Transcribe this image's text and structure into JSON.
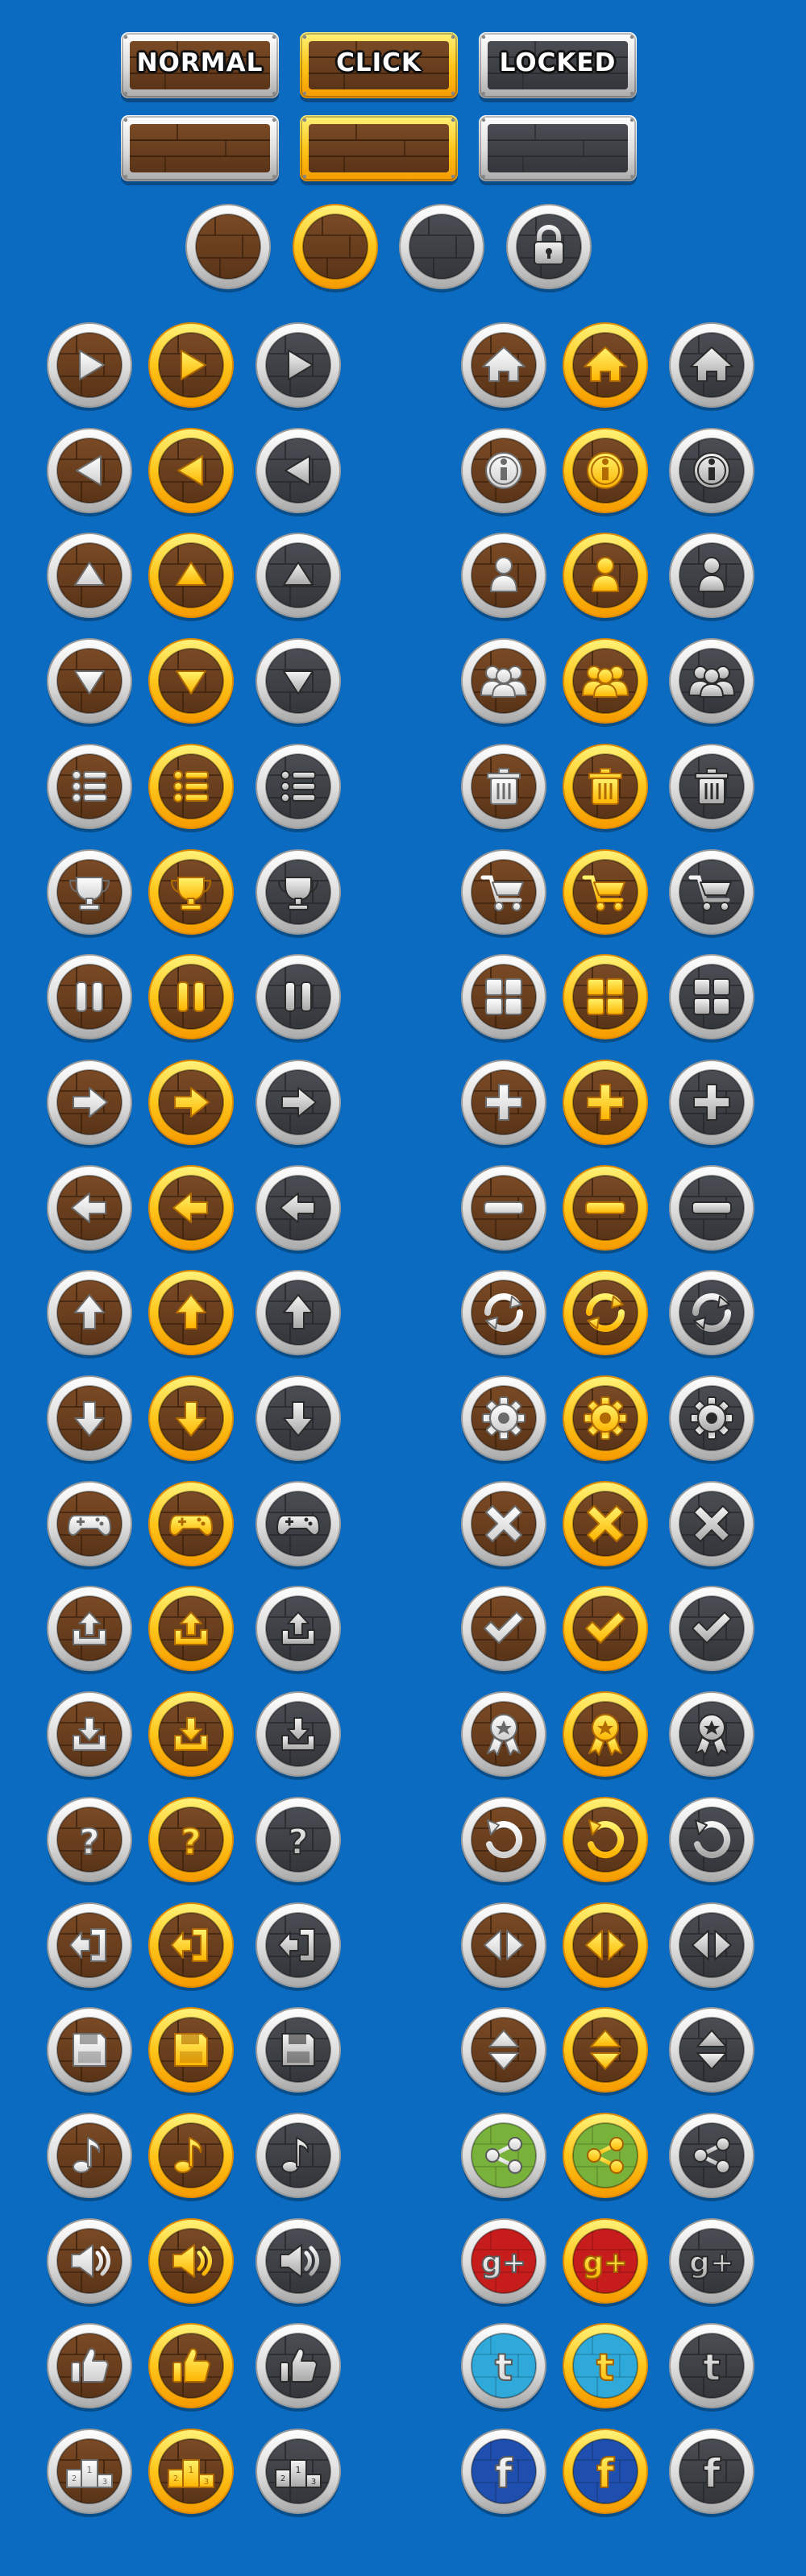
{
  "rect_buttons": [
    {
      "label": "NORMAL",
      "state": "normal",
      "has_label": true
    },
    {
      "label": "CLICK",
      "state": "click",
      "has_label": true
    },
    {
      "label": "LOCKED",
      "state": "locked",
      "has_label": true
    },
    {
      "label": "",
      "state": "normal",
      "has_label": false
    },
    {
      "label": "",
      "state": "click",
      "has_label": false
    },
    {
      "label": "",
      "state": "locked",
      "has_label": false
    }
  ],
  "state_circles": [
    {
      "state": "normal",
      "icon": "none"
    },
    {
      "state": "click",
      "icon": "none"
    },
    {
      "state": "locked",
      "icon": "none"
    },
    {
      "state": "locked",
      "icon": "padlock-icon"
    }
  ],
  "states": [
    "normal",
    "click",
    "locked"
  ],
  "icons_left": [
    "play-icon",
    "arrow-left-triangle-icon",
    "arrow-up-triangle-icon",
    "arrow-down-triangle-icon",
    "list-icon",
    "trophy-icon",
    "pause-icon",
    "arrow-right-icon",
    "arrow-left-icon",
    "arrow-up-icon",
    "arrow-down-icon",
    "gamepad-icon",
    "upload-icon",
    "download-icon",
    "question-icon",
    "exit-icon",
    "save-icon",
    "music-note-icon",
    "sound-icon",
    "thumbs-up-icon",
    "podium-icon"
  ],
  "icons_right": [
    "home-icon",
    "info-icon",
    "user-icon",
    "group-icon",
    "trash-icon",
    "cart-icon",
    "grid-icon",
    "plus-icon",
    "minus-icon",
    "refresh-icon",
    "gear-icon",
    "close-icon",
    "check-icon",
    "award-icon",
    "replay-icon",
    "left-right-icon",
    "up-down-icon",
    "share-icon",
    "google-plus-icon",
    "twitter-icon",
    "facebook-icon"
  ],
  "social_bg": {
    "share-icon": "#79b23a",
    "google-plus-icon": "#c61c1c",
    "twitter-icon": "#2fa9d9",
    "facebook-icon": "#1f4fae"
  },
  "icon_text": {
    "google-plus-icon": "g+",
    "twitter-icon": "t",
    "facebook-icon": "f",
    "question-icon": "?",
    "podium-icon": "2 1 3"
  },
  "colors": {
    "background": "#0b6bc0",
    "wood": "#6a3f1f",
    "wood_dark": "#4a2a12",
    "gold": "#ffc81a",
    "silver": "#e7e7e7",
    "slate": "#3b3e44"
  }
}
